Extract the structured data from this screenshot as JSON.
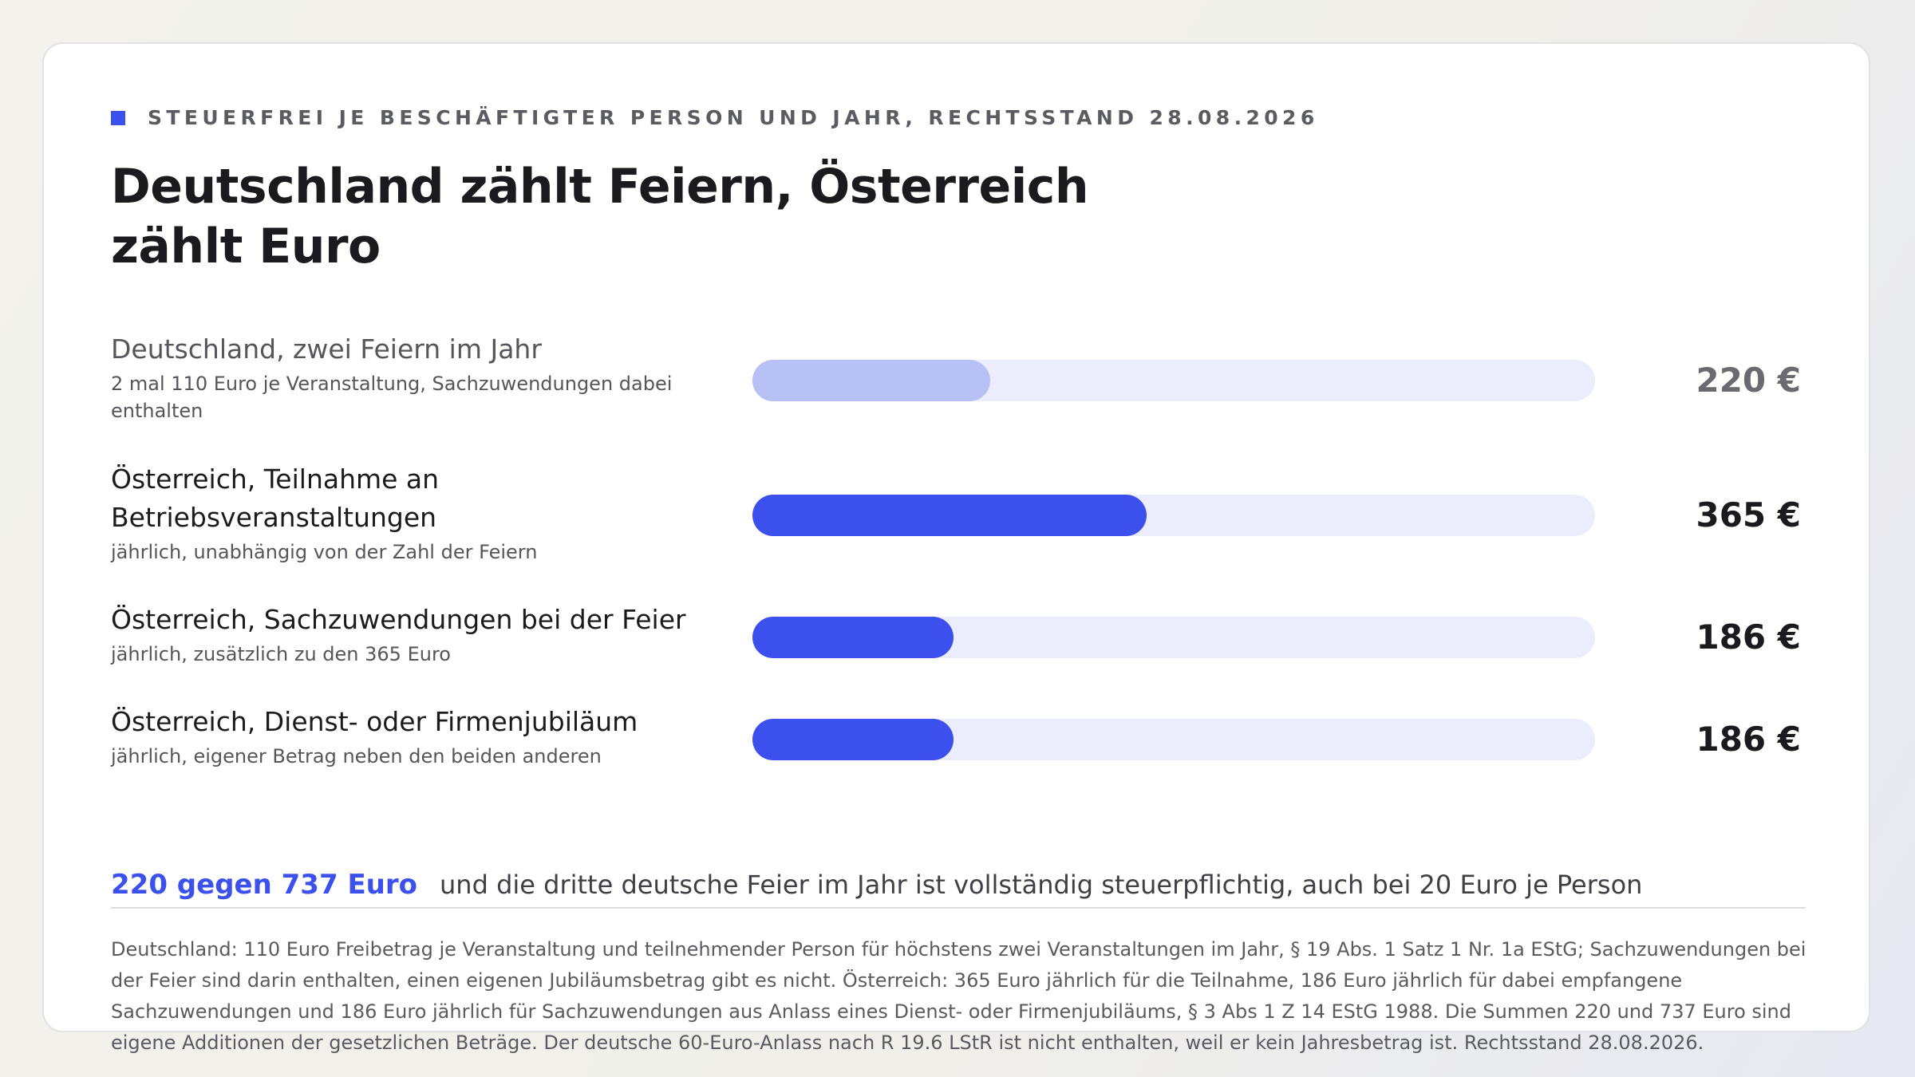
{
  "eyebrow": "STEUERFREI JE BESCHÄFTIGTER PERSON UND JAHR, RECHTSSTAND 28.08.2026",
  "title": "Deutschland zählt Feiern, Österreich zählt Euro",
  "colors": {
    "accent": "#3b50ec",
    "accent_light": "#b8c1f6",
    "track": "#ebecfc"
  },
  "chart_data": {
    "type": "bar",
    "orientation": "horizontal",
    "title": "Deutschland zählt Feiern, Österreich zählt Euro",
    "subtitle": "STEUERFREI JE BESCHÄFTIGTER PERSON UND JAHR, RECHTSSTAND 28.08.2026",
    "unit": "€",
    "xlim": [
      0,
      737
    ],
    "grid": false,
    "categories": [
      "Deutschland, zwei Feiern im Jahr",
      "Österreich, Teilnahme an Betriebsveranstaltungen",
      "Österreich, Sachzuwendungen bei der Feier",
      "Österreich, Dienst- oder Firmenjubiläum"
    ],
    "subtitles": [
      "2 mal 110 Euro je Veranstaltung, Sachzuwendungen dabei enthalten",
      "jährlich, unabhängig von der Zahl der Feiern",
      "jährlich, zusätzlich zu den 365 Euro",
      "jährlich, eigener Betrag neben den beiden anderen"
    ],
    "values": [
      220,
      365,
      186,
      186
    ],
    "value_labels": [
      "220 €",
      "365 €",
      "186 €",
      "186 €"
    ],
    "highlight": [
      false,
      true,
      true,
      true
    ]
  },
  "summary": {
    "figure": "220 gegen 737 Euro",
    "text": "und die dritte deutsche Feier im Jahr ist vollständig steuerpflichtig, auch bei 20 Euro je Person"
  },
  "footnote": "Deutschland: 110 Euro Freibetrag je Veranstaltung und teilnehmender Person für höchstens zwei Veranstaltungen im Jahr, § 19 Abs. 1 Satz 1 Nr. 1a EStG; Sachzuwendungen bei der Feier sind darin enthalten, einen eigenen Jubiläumsbetrag gibt es nicht. Österreich: 365 Euro jährlich für die Teilnahme, 186 Euro jährlich für dabei empfangene Sachzuwendungen und 186 Euro jährlich für Sachzuwendungen aus Anlass eines Dienst- oder Firmenjubiläums, § 3 Abs 1 Z 14 EStG 1988. Die Summen 220 und 737 Euro sind eigene Additionen der gesetzlichen Beträge. Der deutsche 60-Euro-Anlass nach R 19.6 LStR ist nicht enthalten, weil er kein Jahresbetrag ist. Rechtsstand 28.08.2026."
}
